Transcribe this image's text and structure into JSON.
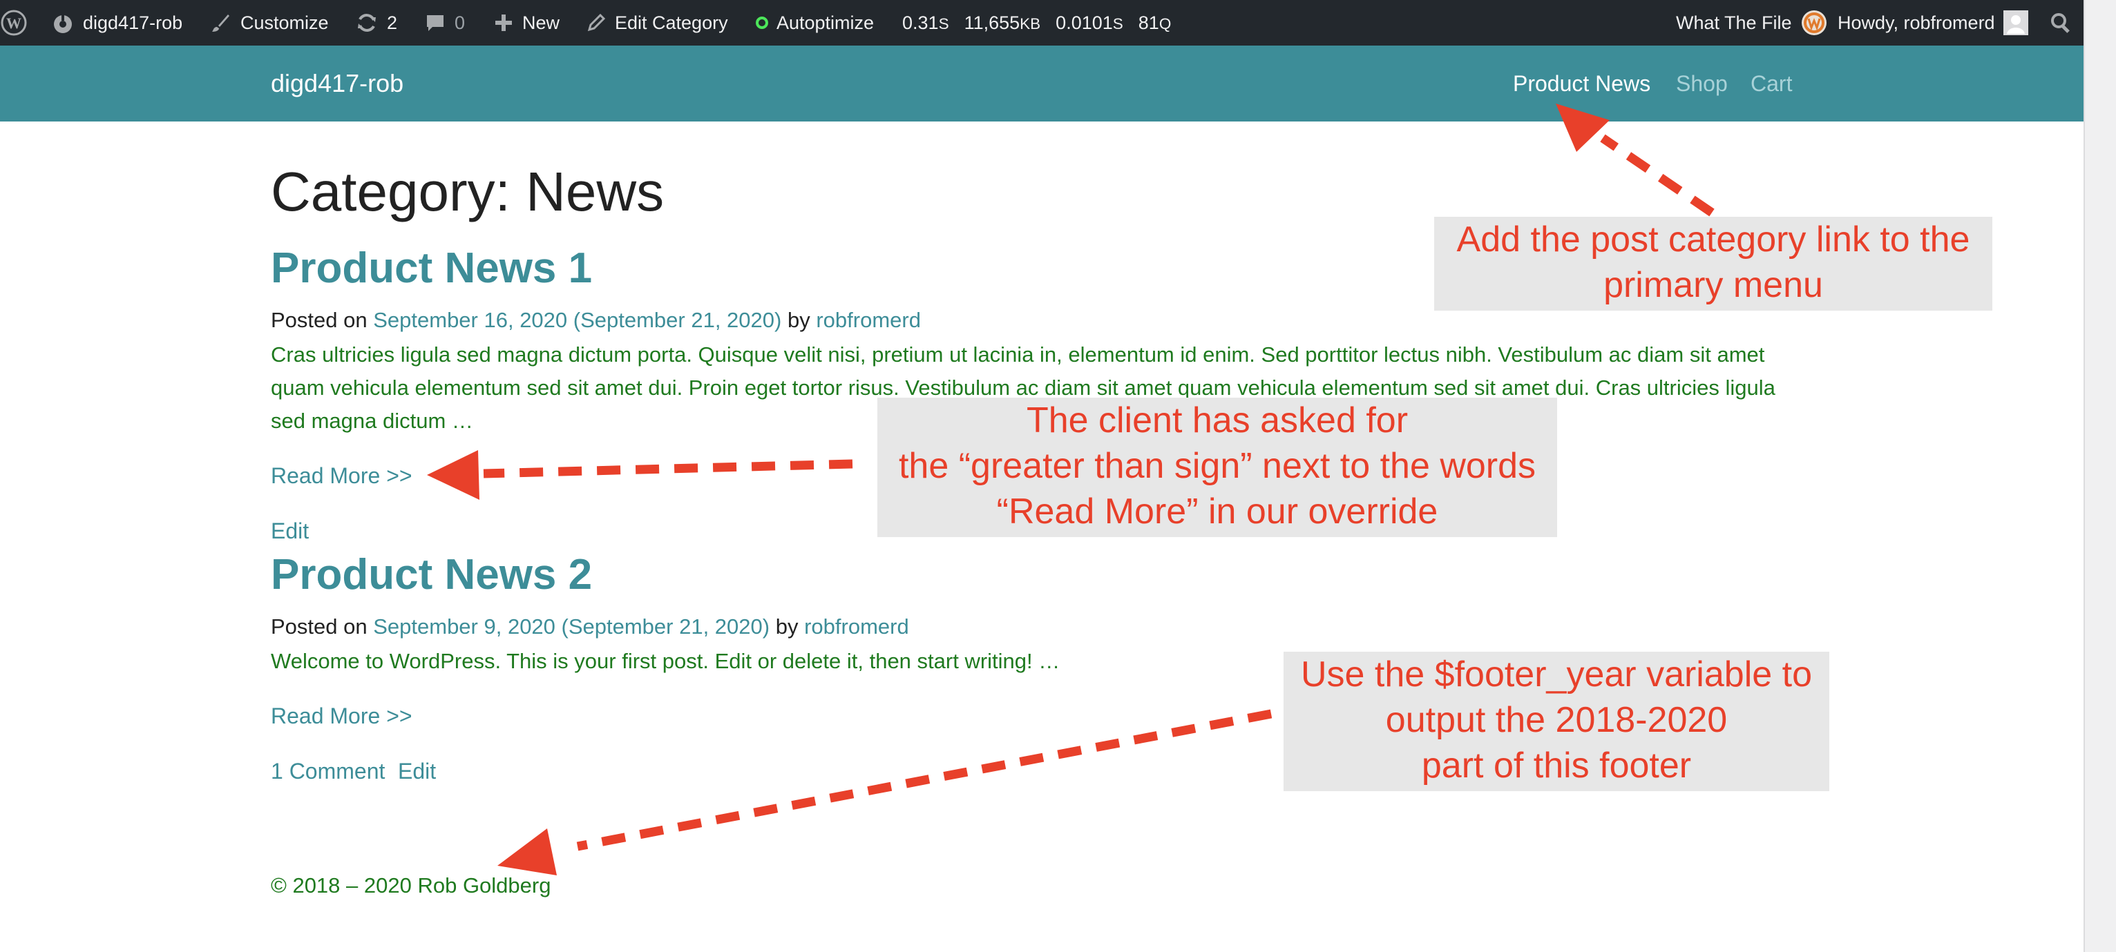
{
  "adminbar": {
    "site_name": "digd417-rob",
    "customize": "Customize",
    "updates_count": "2",
    "comments_count": "0",
    "new_label": "New",
    "edit_category": "Edit Category",
    "autoptimize": "Autoptimize",
    "stat_time": "0.31",
    "stat_time_unit": "S",
    "stat_mem": "11,655",
    "stat_mem_unit": "KB",
    "stat_query_time": "0.0101",
    "stat_query_time_unit": "S",
    "stat_queries": "81",
    "stat_queries_unit": "Q",
    "what_the_file": "What The File",
    "howdy": "Howdy, robfromerd"
  },
  "header": {
    "site_title": "digd417-rob",
    "nav": [
      "Product News",
      "Shop",
      "Cart"
    ]
  },
  "page": {
    "title": "Category: News"
  },
  "posts": [
    {
      "title": "Product News 1",
      "posted_on": "Posted on",
      "date": "September 16, 2020 (September 21, 2020)",
      "by": "by",
      "author": "robfromerd",
      "excerpt": "Cras ultricies ligula sed magna dictum porta. Quisque velit nisi, pretium ut lacinia in, elementum id enim. Sed porttitor lectus nibh. Vestibulum ac diam sit amet quam vehicula elementum sed sit amet dui. Proin eget tortor risus. Vestibulum ac diam sit amet quam vehicula elementum sed sit amet dui. Cras ultricies ligula sed magna dictum …",
      "read_more": "Read More >>",
      "edit": "Edit"
    },
    {
      "title": "Product News 2",
      "posted_on": "Posted on",
      "date": "September 9, 2020 (September 21, 2020)",
      "by": "by",
      "author": "robfromerd",
      "excerpt": "Welcome to WordPress. This is your first post. Edit or delete it, then start writing! …",
      "read_more": "Read More >>",
      "comments": "1 Comment",
      "edit": "Edit"
    }
  ],
  "footer": {
    "text": "© 2018 – 2020 Rob Goldberg"
  },
  "annotations": {
    "menu_note": [
      "Add the post category link to the",
      "primary menu"
    ],
    "readmore_note": [
      "The client has asked for",
      "the “greater than sign” next to the words",
      "“Read More” in our override"
    ],
    "footer_note": [
      "Use the $footer_year variable to",
      "output the 2018-2020",
      "part of this footer"
    ]
  },
  "colors": {
    "adminbar": "#23282d",
    "header": "#3d8d98",
    "link": "#3d8d98",
    "excerpt": "#1f7a1f",
    "annotation": "#e8402a",
    "annotation_bg": "#e7e7e7"
  },
  "icons": [
    "wordpress-icon",
    "dashboard-icon",
    "brush-icon",
    "updates-icon",
    "comment-icon",
    "plus-icon",
    "pencil-icon",
    "status-dot-icon",
    "wtf-logo-icon",
    "avatar",
    "search-icon"
  ]
}
